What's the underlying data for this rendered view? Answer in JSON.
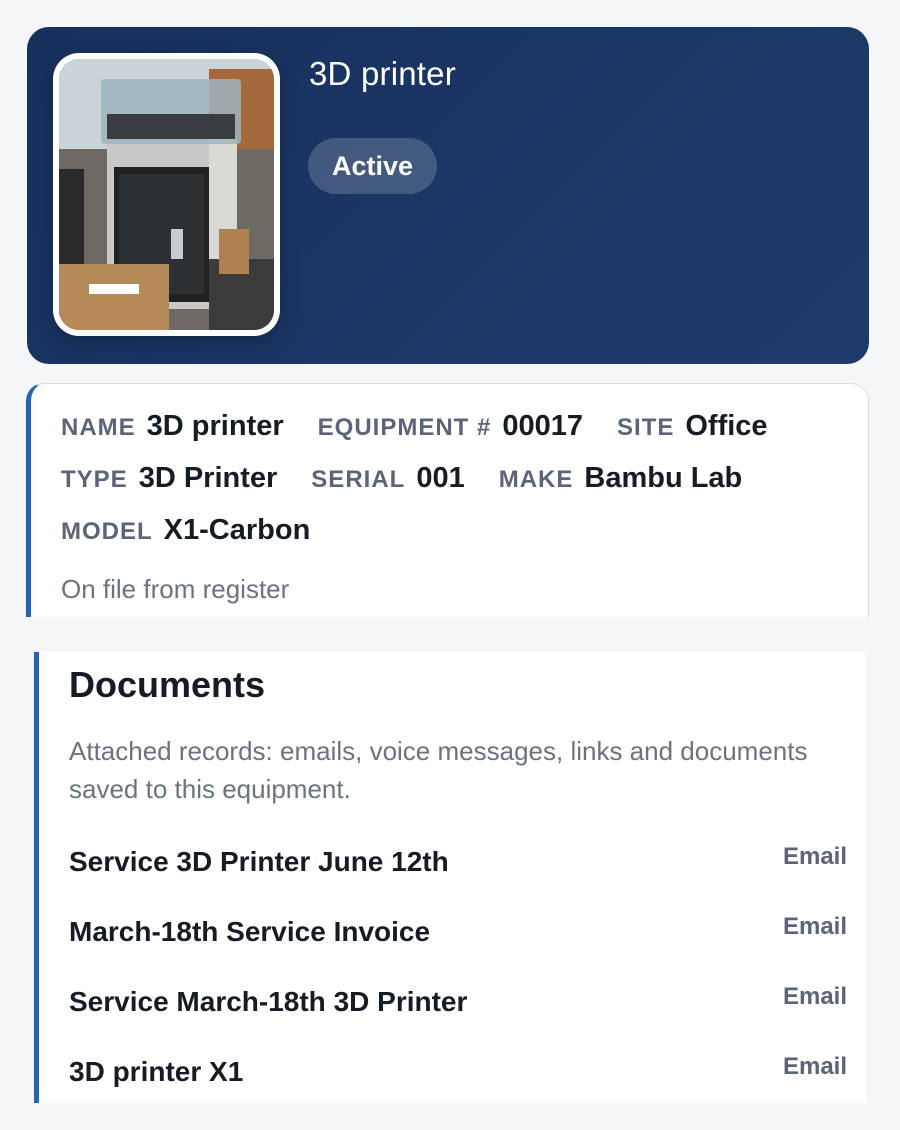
{
  "header": {
    "title": "3D printer",
    "status": "Active",
    "photo_icon": "printer-photo",
    "colors": {
      "background": "#1b3766",
      "pill": "rgba(255,255,255,0.18)"
    }
  },
  "details": {
    "fields": [
      {
        "label": "NAME",
        "value": "3D printer"
      },
      {
        "label": "EQUIPMENT #",
        "value": "00017"
      },
      {
        "label": "SITE",
        "value": "Office"
      },
      {
        "label": "TYPE",
        "value": "3D Printer"
      },
      {
        "label": "SERIAL",
        "value": "001"
      },
      {
        "label": "MAKE",
        "value": "Bambu Lab"
      },
      {
        "label": "MODEL",
        "value": "X1-Carbon"
      }
    ],
    "note": "On file from register",
    "accent_color": "#2563b8"
  },
  "documents": {
    "title": "Documents",
    "description": "Attached records: emails, voice messages, links and documents saved to this equipment.",
    "items": [
      {
        "name": "Service 3D Printer June 12th",
        "type": "Email"
      },
      {
        "name": "March-18th Service Invoice",
        "type": "Email"
      },
      {
        "name": "Service March-18th 3D Printer",
        "type": "Email"
      },
      {
        "name": "3D printer X1",
        "type": "Email"
      }
    ]
  }
}
